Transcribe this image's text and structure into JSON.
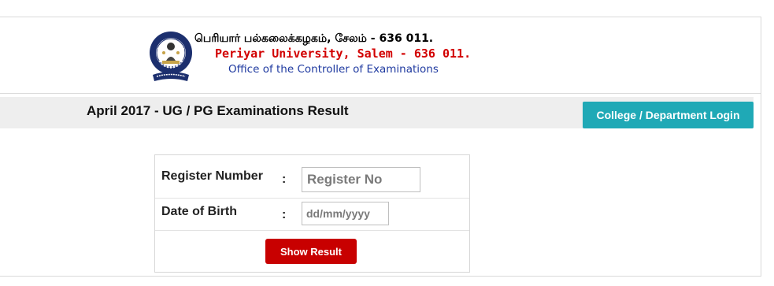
{
  "header": {
    "logo_icon": "periyar-university-emblem-icon",
    "tamil_name": "பெரியார் பல்கலைக்கழகம், சேலம் - 636 011.",
    "english_name": "Periyar University, Salem - 636 011.",
    "office": "Office of the Controller of Examinations"
  },
  "exam": {
    "title": "April 2017 - UG / PG Examinations Result",
    "login_label": "College / Department Login"
  },
  "form": {
    "register_label": "Register Number",
    "register_placeholder": "Register No",
    "dob_label": "Date of Birth",
    "dob_placeholder": "dd/mm/yyyy",
    "separator": ":",
    "submit_label": "Show Result"
  },
  "colors": {
    "login_button": "#1fa9b6",
    "submit_button": "#c80000",
    "english_name": "#d20000",
    "office": "#1f3aa0"
  }
}
